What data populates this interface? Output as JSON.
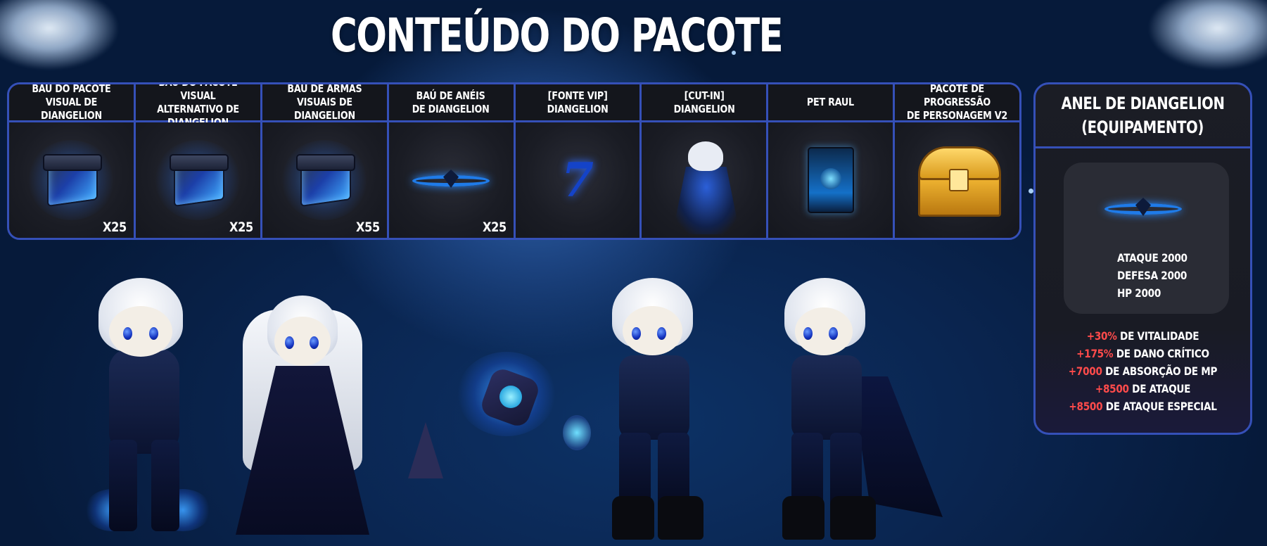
{
  "title": "CONTEÚDO DO PACOTE",
  "items": [
    {
      "name": "BAÚ DO PACOTE\nVISUAL DE DIANGELION",
      "qty": "X25",
      "icon": "box-icon"
    },
    {
      "name": "BAÚ DO PACOTE VISUAL\nALTERNATIVO DE DIANGELION",
      "qty": "X25",
      "icon": "box-icon"
    },
    {
      "name": "BAÚ DE ARMAS\nVISUAIS DE DIANGELION",
      "qty": "X55",
      "icon": "box-icon"
    },
    {
      "name": "BAÚ DE ANÉIS\nDE DIANGELION",
      "qty": "X25",
      "icon": "ring-icon"
    },
    {
      "name": "[FONTE VIP]\nDIANGELION",
      "qty": "",
      "icon": "font-icon",
      "glyph": "7"
    },
    {
      "name": "[CUT-IN]\nDIANGELION",
      "qty": "",
      "icon": "cut-in-icon"
    },
    {
      "name": "PET RAUL",
      "qty": "",
      "icon": "pet-card-icon"
    },
    {
      "name": "PACOTE DE PROGRESSÃO\nDE PERSONAGEM V2",
      "qty": "",
      "icon": "golden-chest-icon"
    }
  ],
  "panel": {
    "title_line1": "ANEL DE DIANGELION",
    "title_line2": "(EQUIPAMENTO)",
    "base_stats": [
      "ATAQUE 2000",
      "DEFESA 2000",
      "HP 2000"
    ],
    "bonuses": [
      {
        "value": "+30%",
        "text": "DE VITALIDADE"
      },
      {
        "value": "+175%",
        "text": "DE DANO CRÍTICO"
      },
      {
        "value": "+7000",
        "text": "DE ABSORÇÃO DE MP"
      },
      {
        "value": "+8500",
        "text": "DE ATAQUE"
      },
      {
        "value": "+8500",
        "text": "DE ATAQUE ESPECIAL"
      }
    ]
  },
  "colors": {
    "border": "#3550b8",
    "bonus_value": "#ff4b4b",
    "background": "#0a2550"
  }
}
